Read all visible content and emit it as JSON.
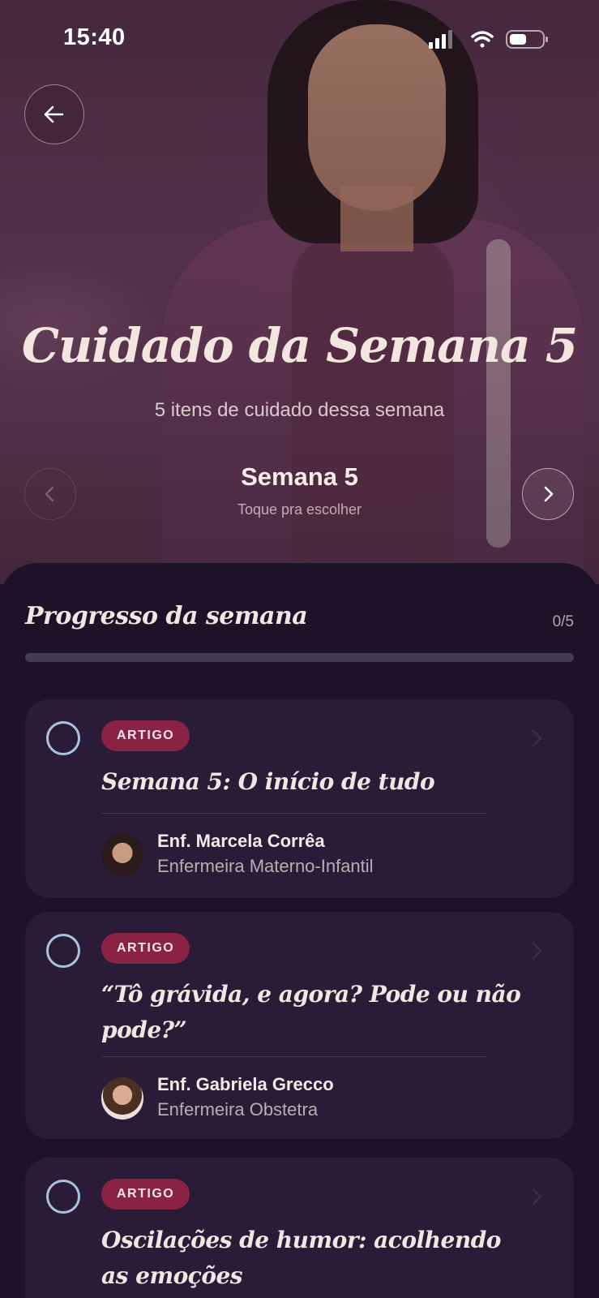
{
  "status_bar": {
    "time": "15:40"
  },
  "hero": {
    "title": "Cuidado da Semana 5",
    "subtitle": "5 itens de cuidado dessa semana",
    "week_label": "Semana 5",
    "week_hint": "Toque pra escolher"
  },
  "icons": {
    "back": "arrow-left-icon",
    "prev": "chevron-left-icon",
    "next": "chevron-right-icon",
    "signal": "cellular-signal-icon",
    "wifi": "wifi-icon",
    "battery": "battery-icon"
  },
  "progress": {
    "title": "Progresso da semana",
    "count": "0/5",
    "fraction": 0
  },
  "items": [
    {
      "tag": "ARTIGO",
      "title": "Semana 5:  O início de tudo",
      "author_name": "Enf. Marcela Corrêa",
      "author_role": "Enfermeira Materno-Infantil",
      "completed": false
    },
    {
      "tag": "ARTIGO",
      "title": "“Tô grávida, e agora? Pode ou não pode?”",
      "author_name": "Enf. Gabriela Grecco",
      "author_role": "Enfermeira Obstetra",
      "completed": false
    },
    {
      "tag": "ARTIGO",
      "title": "Oscilações de humor: acolhendo as emoções",
      "completed": false
    }
  ],
  "colors": {
    "background": "#1e1229",
    "card": "#2a1b37",
    "tag": "#8a2244",
    "check_ring": "#a8c4dc"
  }
}
